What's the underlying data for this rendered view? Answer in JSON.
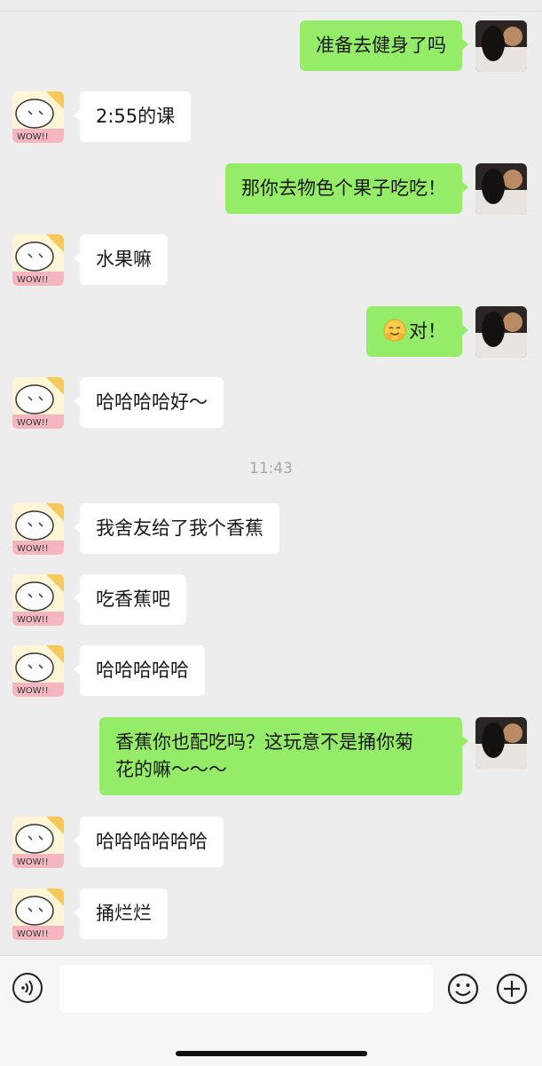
{
  "timestamp": "11:43",
  "messages": [
    {
      "side": "right",
      "text": "准备去健身了吗"
    },
    {
      "side": "left",
      "text": "2:55的课"
    },
    {
      "side": "right",
      "text": "那你去物色个果子吃吃！"
    },
    {
      "side": "left",
      "text": "水果嘛"
    },
    {
      "side": "right",
      "emoji": "hugging-face-emoji",
      "text": "对！"
    },
    {
      "side": "left",
      "text": "哈哈哈哈好～"
    },
    {
      "side": "left",
      "text": "我舍友给了我个香蕉"
    },
    {
      "side": "left",
      "text": "吃香蕉吧"
    },
    {
      "side": "left",
      "text": "哈哈哈哈哈"
    },
    {
      "side": "right",
      "text": "香蕉你也配吃吗？这玩意不是捅你菊\n花的嘛～～～"
    },
    {
      "side": "left",
      "text": "哈哈哈哈哈哈"
    },
    {
      "side": "left",
      "text": "捅烂烂"
    }
  ],
  "avatars": {
    "friend": {
      "icon": "cartoon-bunny-avatar",
      "caption": "WOW!!"
    },
    "me": {
      "icon": "photo-avatar-person-with-cat"
    }
  },
  "input_bar": {
    "value": "",
    "voice_icon": "voice-icon",
    "emoji_icon": "emoji-icon",
    "plus_icon": "plus-icon"
  },
  "colors": {
    "background": "#ededed",
    "outgoing_bubble": "#95ec69",
    "incoming_bubble": "#ffffff",
    "timestamp": "#a6a6a6"
  }
}
